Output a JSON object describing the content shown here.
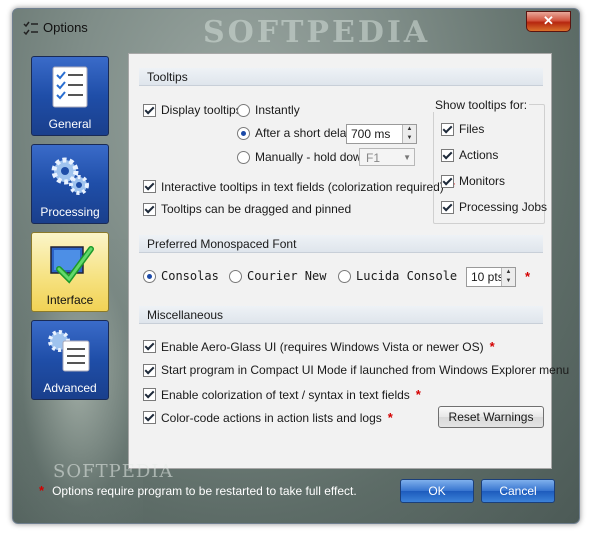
{
  "window": {
    "title": "Options",
    "close_label": "✕",
    "watermark": "SOFTPEDIA",
    "watermark_bottom": "SOFTPEDIA"
  },
  "nav": [
    {
      "label": "General",
      "icon": "checklist-icon"
    },
    {
      "label": "Processing",
      "icon": "gears-icon"
    },
    {
      "label": "Interface",
      "icon": "monitor-check-icon"
    },
    {
      "label": "Advanced",
      "icon": "checklist-gear-icon"
    }
  ],
  "tooltips": {
    "header": "Tooltips",
    "display_label": "Display tooltips:",
    "instantly_label": "Instantly",
    "short_delay_label": "After a short delay:",
    "delay_value": "700 ms",
    "manually_label": "Manually - hold down:",
    "manual_key": "F1",
    "interactive_label": "Interactive tooltips in text fields (colorization required)",
    "dragged_label": "Tooltips can be dragged and pinned",
    "show_for_label": "Show tooltips for:",
    "show_for": [
      "Files",
      "Actions",
      "Monitors",
      "Processing Jobs"
    ]
  },
  "font": {
    "header": "Preferred Monospaced Font",
    "options": [
      "Consolas",
      "Courier New",
      "Lucida Console"
    ],
    "size_value": "10 pts"
  },
  "misc": {
    "header": "Miscellaneous",
    "aero_label": "Enable Aero-Glass UI (requires Windows Vista or newer OS)",
    "compact_label": "Start program in Compact UI Mode if launched from Windows Explorer menu",
    "colorize_label": "Enable colorization of text / syntax in text fields",
    "colorcode_label": "Color-code actions in action lists and logs",
    "reset_label": "Reset Warnings"
  },
  "footer": {
    "note": "Options require program to be restarted to take full effect.",
    "ok_label": "OK",
    "cancel_label": "Cancel"
  },
  "colors": {
    "required_star": "#d40000",
    "active_nav": "#f6e17e",
    "nav_blue": "#1f4ea8"
  }
}
